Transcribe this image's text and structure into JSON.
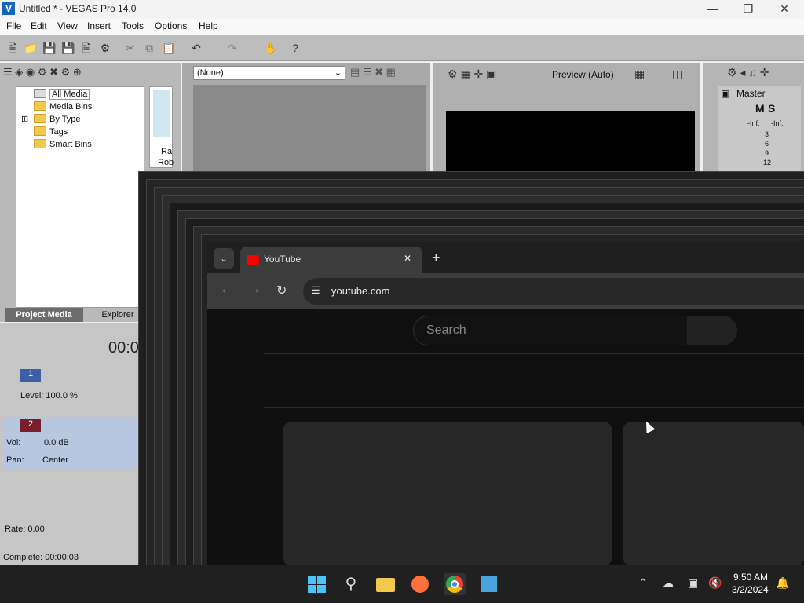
{
  "window": {
    "title": "Untitled * - VEGAS Pro 14.0",
    "app_letter": "V"
  },
  "menu": [
    "File",
    "Edit",
    "View",
    "Insert",
    "Tools",
    "Options",
    "Help"
  ],
  "trimmer": {
    "dropdown_value": "(None)"
  },
  "preview": {
    "mode_label": "Preview (Auto)"
  },
  "master": {
    "label": "Master",
    "m": "M",
    "s": "S",
    "left_db": "-Inf.",
    "right_db": "-Inf.",
    "ticks": [
      "3",
      "6",
      "9",
      "12"
    ]
  },
  "media_tree": [
    "All Media",
    "Media Bins",
    "By Type",
    "Tags",
    "Smart Bins"
  ],
  "media_thumb": {
    "line1": "Ra",
    "line2": "Rob"
  },
  "tabs": {
    "project_media": "Project Media",
    "explorer": "Explorer"
  },
  "timecode": "00:0",
  "track1": {
    "number": "1",
    "level": "Level: 100.0 %"
  },
  "track2": {
    "number": "2",
    "vol_label": "Vol:",
    "vol_value": "0.0 dB",
    "pan_label": "Pan:",
    "pan_value": "Center"
  },
  "status": {
    "rate": "Rate: 0.00",
    "complete": "Complete: 00:00:03"
  },
  "chrome": {
    "tab_title": "YouTube",
    "url": "youtube.com",
    "search_placeholder": "Search"
  },
  "taskbar": {
    "time": "9:50 AM",
    "date": "3/2/2024"
  },
  "colors": {
    "youtube_red": "#ff0000",
    "vegas_blue": "#1565c0",
    "track_blue": "#b8c7e0",
    "chrome_dark": "#0f0f0f"
  }
}
